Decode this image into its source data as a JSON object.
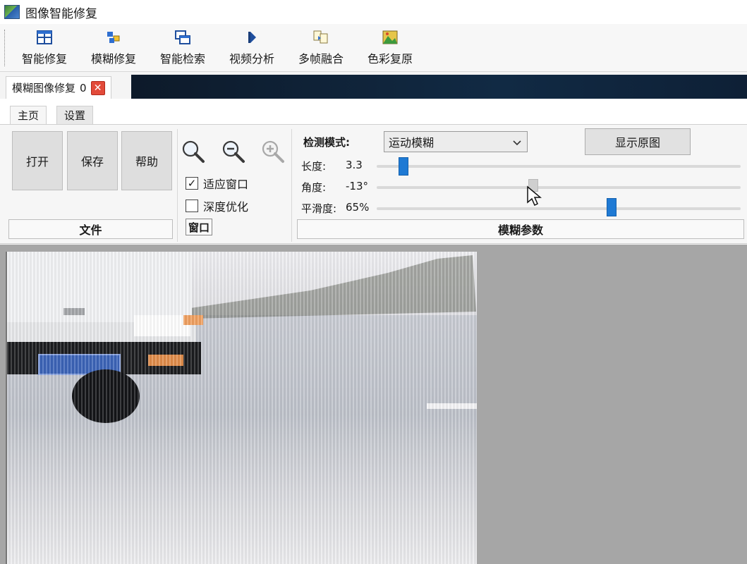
{
  "window": {
    "title": "图像智能修复"
  },
  "toolbar": {
    "items": [
      {
        "label": "智能修复",
        "icon": "grid-windows-icon"
      },
      {
        "label": "模糊修复",
        "icon": "blocks-icon"
      },
      {
        "label": "智能检索",
        "icon": "stacked-windows-icon"
      },
      {
        "label": "视频分析",
        "icon": "play-icon"
      },
      {
        "label": "多帧融合",
        "icon": "merge-pages-icon"
      },
      {
        "label": "色彩复原",
        "icon": "color-image-icon"
      }
    ]
  },
  "document_tab": {
    "label": "模糊图像修复",
    "count": "0"
  },
  "ribbon_tabs": [
    "主页",
    "设置"
  ],
  "file_group": {
    "buttons": [
      "打开",
      "保存",
      "帮助"
    ],
    "label": "文件"
  },
  "window_group": {
    "label": "窗口",
    "checkboxes": [
      {
        "label": "适应窗口",
        "checked": true
      },
      {
        "label": "深度优化",
        "checked": false
      }
    ]
  },
  "blur_group": {
    "label": "模糊参数",
    "mode_label": "检测模式:",
    "mode_value": "运动模糊",
    "show_original": "显示原图",
    "length_label": "长度:",
    "length_value": "3.3",
    "angle_label": "角度:",
    "angle_value": "-13°",
    "smooth_label": "平滑度:",
    "smooth_value": "65%"
  },
  "colors": {
    "accent": "#1f7ad4",
    "close": "#e24a3a",
    "canvas": "#a6a6a6"
  }
}
